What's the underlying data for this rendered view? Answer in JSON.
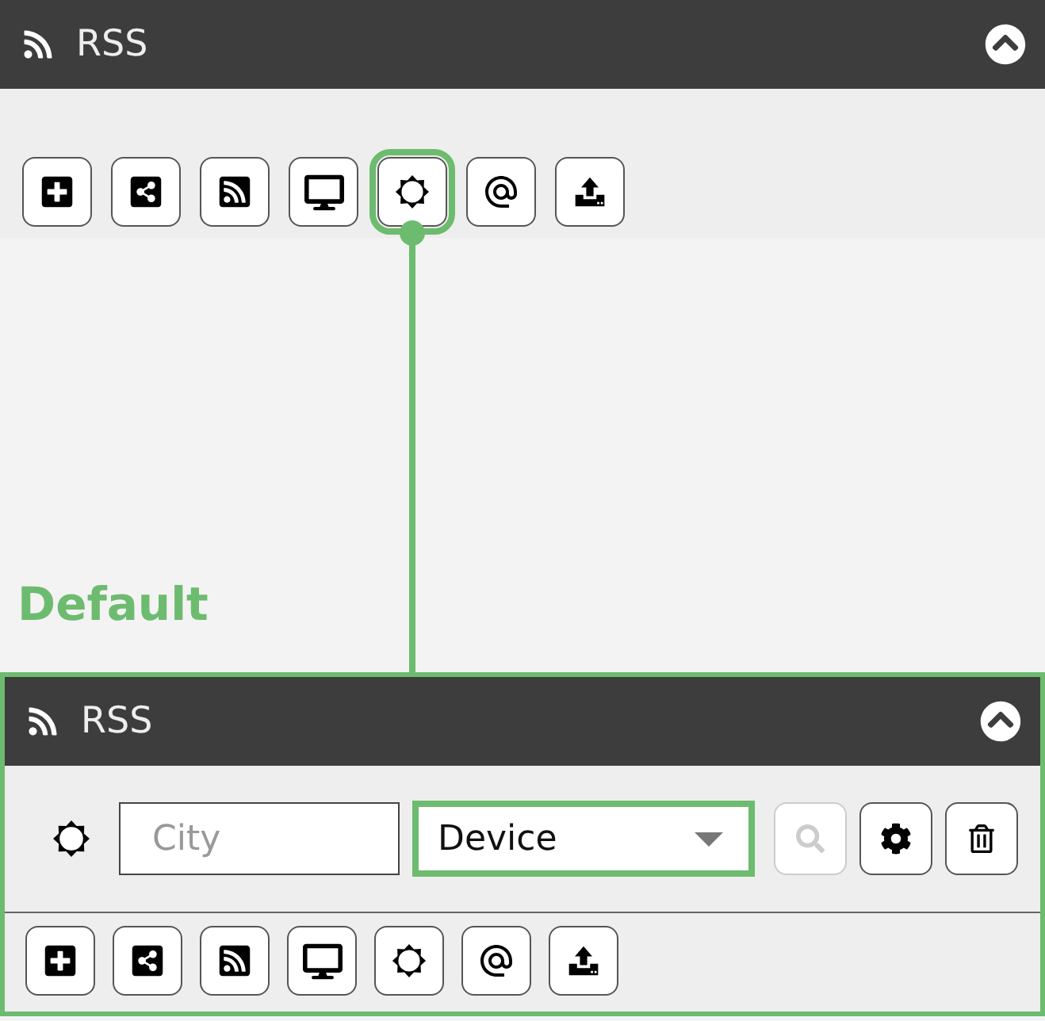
{
  "top_panel": {
    "title": "RSS",
    "toolbar": [
      {
        "kind": "plus",
        "selected": false
      },
      {
        "kind": "share",
        "selected": false
      },
      {
        "kind": "rss",
        "selected": false
      },
      {
        "kind": "desktop",
        "selected": false
      },
      {
        "kind": "sun",
        "selected": true
      },
      {
        "kind": "at",
        "selected": false
      },
      {
        "kind": "upload",
        "selected": false
      }
    ]
  },
  "caption": "Default",
  "bottom_panel": {
    "title": "RSS",
    "city_field": {
      "placeholder": "City"
    },
    "device_select": {
      "value": "Device",
      "selected": true
    },
    "actions": [
      {
        "kind": "search",
        "disabled": true
      },
      {
        "kind": "settings",
        "disabled": false
      },
      {
        "kind": "trash",
        "disabled": false
      }
    ],
    "toolbar": [
      {
        "kind": "plus",
        "selected": false
      },
      {
        "kind": "share",
        "selected": false
      },
      {
        "kind": "rss",
        "selected": false
      },
      {
        "kind": "desktop",
        "selected": false
      },
      {
        "kind": "sun",
        "selected": false
      },
      {
        "kind": "at",
        "selected": false
      },
      {
        "kind": "upload",
        "selected": false
      }
    ]
  }
}
